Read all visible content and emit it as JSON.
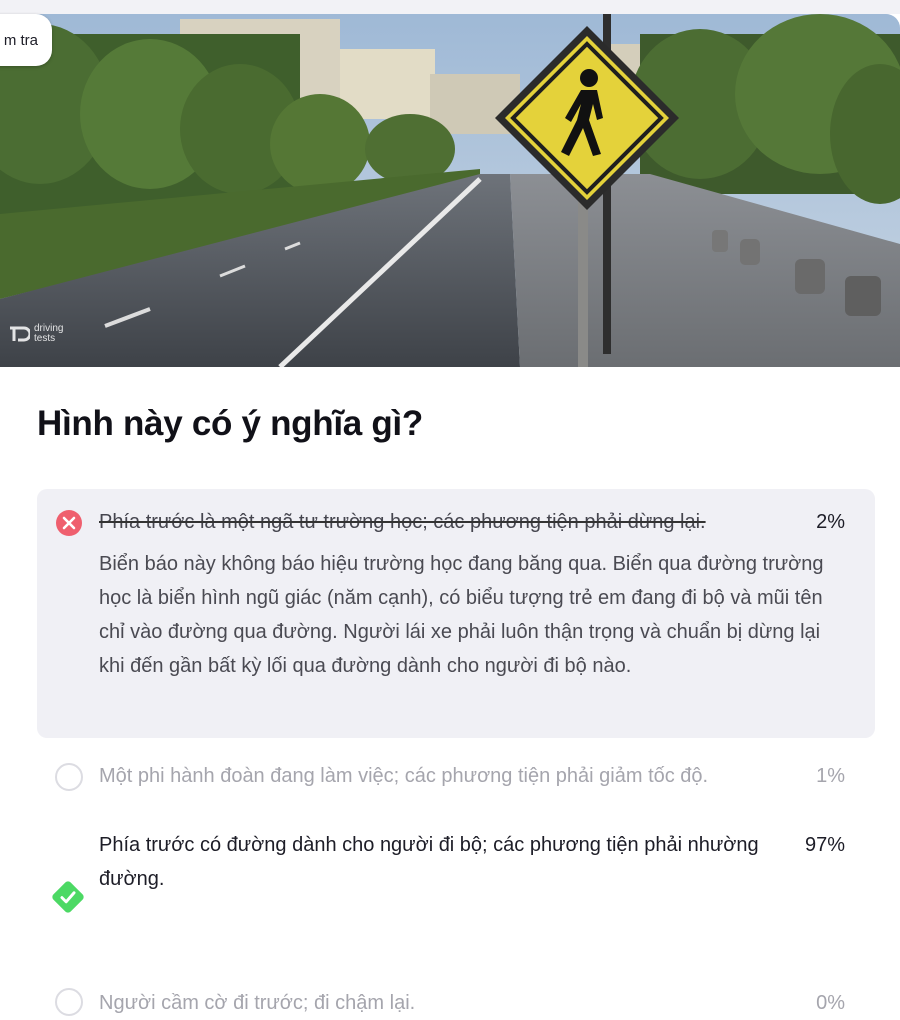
{
  "header": {
    "pill_label": "m tra"
  },
  "hero": {
    "watermark": "driving tests",
    "image_description_icon": "pedestrian-crossing-sign"
  },
  "question": {
    "title": "Hình này có ý nghĩa gì?"
  },
  "answers": [
    {
      "text": "Phía trước là một ngã tư trường học; các phương tiện phải dừng lại.",
      "percent": "2%",
      "state": "wrong",
      "explanation": "Biển báo này không báo hiệu trường học đang băng qua. Biển qua đường trường học là biển hình ngũ giác (năm cạnh), có biểu tượng trẻ em đang đi bộ và mũi tên chỉ vào đường qua đường. Người lái xe phải luôn thận trọng và chuẩn bị dừng lại khi đến gần bất kỳ lối qua đường dành cho người đi bộ nào."
    },
    {
      "text": "Một phi hành đoàn đang làm việc; các phương tiện phải giảm tốc độ.",
      "percent": "1%",
      "state": "unselected"
    },
    {
      "text": "Phía trước có đường dành cho người đi bộ; các phương tiện phải nhường đường.",
      "percent": "97%",
      "state": "correct"
    },
    {
      "text": "Người cầm cờ đi trước; đi chậm lại.",
      "percent": "0%",
      "state": "unselected"
    }
  ],
  "colors": {
    "wrong": "#ef5f6e",
    "correct": "#4cd964",
    "card_bg": "#f0f0f5",
    "muted_text": "#a5a5ad"
  }
}
